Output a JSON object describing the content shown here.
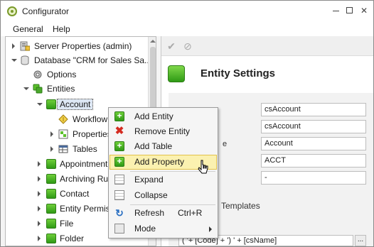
{
  "window": {
    "title": "Configurator"
  },
  "menubar": {
    "items": [
      "General",
      "Help"
    ]
  },
  "tree": {
    "items": [
      {
        "label": "Server Properties (admin)"
      },
      {
        "label": "Database \"CRM for Sales Sa..."
      },
      {
        "label": "Options"
      },
      {
        "label": "Entities"
      },
      {
        "label": "Account"
      },
      {
        "label": "Workflow"
      },
      {
        "label": "Properties"
      },
      {
        "label": "Tables"
      },
      {
        "label": "Appointment"
      },
      {
        "label": "Archiving Rule"
      },
      {
        "label": "Contact"
      },
      {
        "label": "Entity Permissi"
      },
      {
        "label": "File"
      },
      {
        "label": "Folder"
      }
    ]
  },
  "settings": {
    "title": "Entity Settings",
    "fields": [
      "csAccount",
      "csAccount",
      "Account",
      "ACCT",
      "-"
    ],
    "partial_label": "e",
    "templates_label": "Templates",
    "template_value": "( '+ [Code] + ') ' + [csName]",
    "template_button": "..."
  },
  "context_menu": {
    "items": [
      {
        "label": "Add Entity",
        "icon": "plus-icon"
      },
      {
        "label": "Remove Entity",
        "icon": "x-icon"
      },
      {
        "label": "Add Table",
        "icon": "plus-icon"
      },
      {
        "label": "Add Property",
        "icon": "plus-icon"
      },
      {
        "label": "Expand",
        "icon": "expand-icon"
      },
      {
        "label": "Collapse",
        "icon": "collapse-icon"
      },
      {
        "label": "Refresh",
        "icon": "refresh-icon",
        "shortcut": "Ctrl+R"
      },
      {
        "label": "Mode",
        "icon": "mode-icon"
      }
    ]
  },
  "colors": {
    "accent_green": "#3aa81c",
    "highlight": "#fbf1b0",
    "highlight_border": "#e2c24a"
  }
}
